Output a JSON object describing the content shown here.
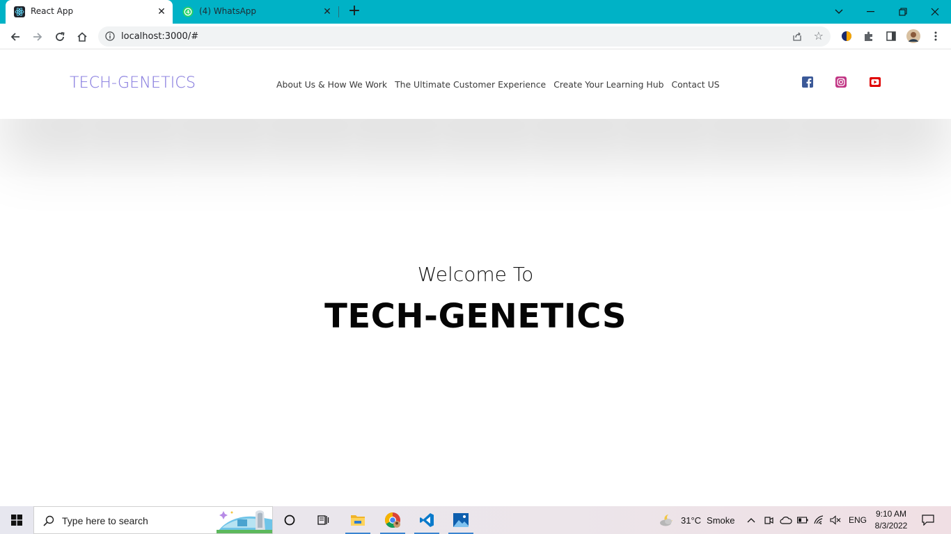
{
  "browser": {
    "tabs": [
      {
        "title": "React App",
        "active": true
      },
      {
        "title": "(4) WhatsApp",
        "active": false
      }
    ],
    "url": "localhost:3000/#"
  },
  "site": {
    "logo": "TECH-GENETICS",
    "nav": [
      {
        "label": "About Us & How We Work"
      },
      {
        "label": "The Ultimate Customer Experience"
      },
      {
        "label": "Create Your Learning Hub"
      },
      {
        "label": "Contact US"
      }
    ],
    "social": [
      "facebook-icon",
      "instagram-icon",
      "youtube-icon"
    ],
    "hero": {
      "welcome": "Welcome To",
      "title": "TECH-GENETICS"
    },
    "colors": {
      "tab_strip": "#00b2c6",
      "logo": "#8b80e0",
      "facebook": "#3b5998",
      "instagram": "#c13584",
      "youtube": "#e00000"
    }
  },
  "taskbar": {
    "search_placeholder": "Type here to search",
    "weather_temp": "31°C",
    "weather_desc": "Smoke",
    "language": "ENG",
    "time": "9:10 AM",
    "date": "8/3/2022"
  }
}
